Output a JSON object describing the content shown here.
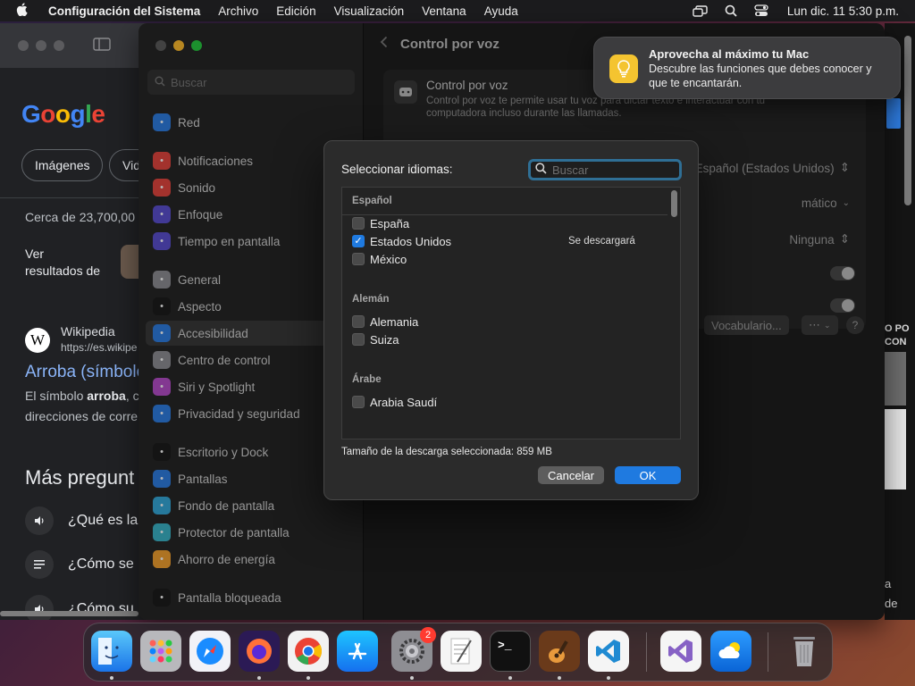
{
  "menubar": {
    "app_name": "Configuración del Sistema",
    "items": [
      "Archivo",
      "Edición",
      "Visualización",
      "Ventana",
      "Ayuda"
    ],
    "clock": "Lun dic. 11  5:30 p.m."
  },
  "browser": {
    "logo": [
      "G",
      "o",
      "o",
      "g",
      "l",
      "e"
    ],
    "chip_images": "Imágenes",
    "chip_videos": "Vid",
    "results_count": "Cerca de 23,700,00",
    "see_results_line1": "Ver",
    "see_results_line2": "resultados de",
    "wiki_letter": "W",
    "wiki_name": "Wikipedia",
    "wiki_url": "https://es.wikipe",
    "result_title": "Arroba (símbolo",
    "snippet_line1_pre": "El símbolo ",
    "snippet_line1_bold": "arroba",
    "snippet_line1_post": ", c",
    "snippet_line2": "direcciones de corre",
    "more_questions": "Más pregunt",
    "questions": [
      "¿Qué es la",
      "¿Cómo se",
      "¿Cómo su"
    ]
  },
  "settings": {
    "search_placeholder": "Buscar",
    "sidebar": [
      {
        "label": "Red",
        "icon": "globe-icon",
        "color": "#2f7de1"
      },
      {
        "label": "Notificaciones",
        "icon": "bell-icon",
        "color": "#e2463f"
      },
      {
        "label": "Sonido",
        "icon": "speaker-icon",
        "color": "#e2463f"
      },
      {
        "label": "Enfoque",
        "icon": "moon-icon",
        "color": "#5a4fcf"
      },
      {
        "label": "Tiempo en pantalla",
        "icon": "hourglass-icon",
        "color": "#5a4fcf"
      },
      {
        "label": "General",
        "icon": "gear-icon",
        "color": "#8e8e93"
      },
      {
        "label": "Aspecto",
        "icon": "appearance-icon",
        "color": "#1c1c1c"
      },
      {
        "label": "Accesibilidad",
        "icon": "accessibility-icon",
        "color": "#2f7de1"
      },
      {
        "label": "Centro de control",
        "icon": "control-center-icon",
        "color": "#8e8e93"
      },
      {
        "label": "Siri y Spotlight",
        "icon": "siri-icon",
        "color": "#b64ec9"
      },
      {
        "label": "Privacidad y seguridad",
        "icon": "hand-icon",
        "color": "#2f7de1"
      },
      {
        "label": "Escritorio y Dock",
        "icon": "dock-icon",
        "color": "#1c1c1c"
      },
      {
        "label": "Pantallas",
        "icon": "sun-icon",
        "color": "#2f7de1"
      },
      {
        "label": "Fondo de pantalla",
        "icon": "wallpaper-icon",
        "color": "#35a8d8"
      },
      {
        "label": "Protector de pantalla",
        "icon": "screensaver-icon",
        "color": "#3bb3c7"
      },
      {
        "label": "Ahorro de energía",
        "icon": "battery-icon",
        "color": "#f0a030"
      },
      {
        "label": "Pantalla bloqueada",
        "icon": "lock-icon",
        "color": "#1c1c1c"
      }
    ],
    "header_title": "Control por voz",
    "card_title": "Control por voz",
    "card_desc": "Control por voz te permite usar tu voz para dictar texto e interactuar con tu computadora incluso durante las llamadas.",
    "language_value": "Español (Estados Unidos)",
    "mic_value": "mático",
    "sound_value": "Ninguna",
    "vocab_button": "Vocabulario...",
    "more_button": "⋯",
    "help_button": "?"
  },
  "dialog": {
    "title": "Seleccionar idiomas:",
    "search_placeholder": "Buscar",
    "groups": [
      {
        "name": "Español",
        "items": [
          {
            "label": "España",
            "checked": false,
            "status": ""
          },
          {
            "label": "Estados Unidos",
            "checked": true,
            "status": "Se descargará"
          },
          {
            "label": "México",
            "checked": false,
            "status": ""
          }
        ]
      },
      {
        "name": "Alemán",
        "items": [
          {
            "label": "Alemania",
            "checked": false,
            "status": ""
          },
          {
            "label": "Suiza",
            "checked": false,
            "status": ""
          }
        ]
      },
      {
        "name": "Árabe",
        "items": [
          {
            "label": "Arabia Saudí",
            "checked": false,
            "status": ""
          }
        ]
      }
    ],
    "download_size": "Tamaño de la descarga seleccionada: 859 MB",
    "cancel_label": "Cancelar",
    "ok_label": "OK"
  },
  "notification": {
    "title": "Aprovecha al máximo tu Mac",
    "body": "Descubre las funciones que debes conocer y que te encantarán."
  },
  "right_strip": {
    "line1": "O PO",
    "line2": "CON",
    "line3": "a",
    "line4": "de"
  },
  "dock": {
    "settings_badge": "2",
    "terminal_glyph": ">_"
  }
}
